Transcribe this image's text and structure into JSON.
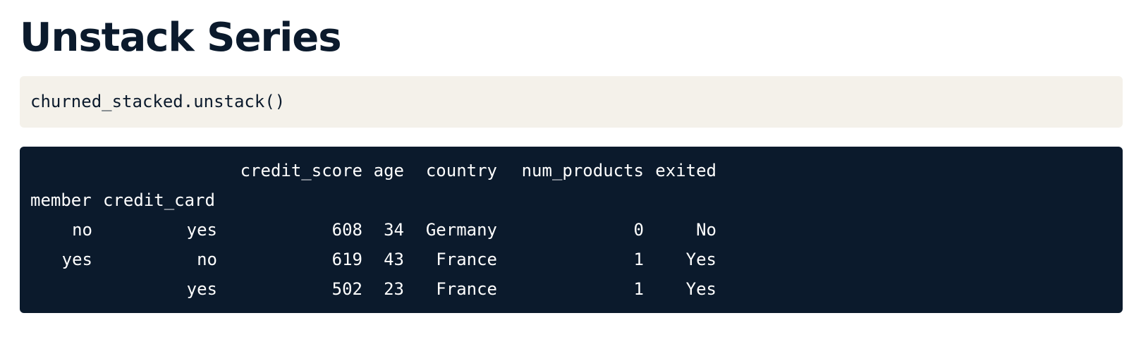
{
  "page": {
    "title": "Unstack Series"
  },
  "code": {
    "input": "churned_stacked.unstack()"
  },
  "output": {
    "column_headers": [
      "credit_score",
      "age",
      "country",
      "num_products",
      "exited"
    ],
    "index_headers": [
      "member",
      "credit_card"
    ],
    "rows": [
      {
        "member": "no",
        "credit_card": "yes",
        "credit_score": "608",
        "age": "34",
        "country": "Germany",
        "num_products": "0",
        "exited": "No"
      },
      {
        "member": "yes",
        "credit_card": "no",
        "credit_score": "619",
        "age": "43",
        "country": "France",
        "num_products": "1",
        "exited": "Yes"
      },
      {
        "member": "",
        "credit_card": "yes",
        "credit_score": "502",
        "age": "23",
        "country": "France",
        "num_products": "1",
        "exited": "Yes"
      }
    ]
  },
  "colors": {
    "title": "#0b1a2c",
    "code_background": "#f4f1ea",
    "output_background": "#0b1a2c",
    "output_text": "#ffffff"
  }
}
